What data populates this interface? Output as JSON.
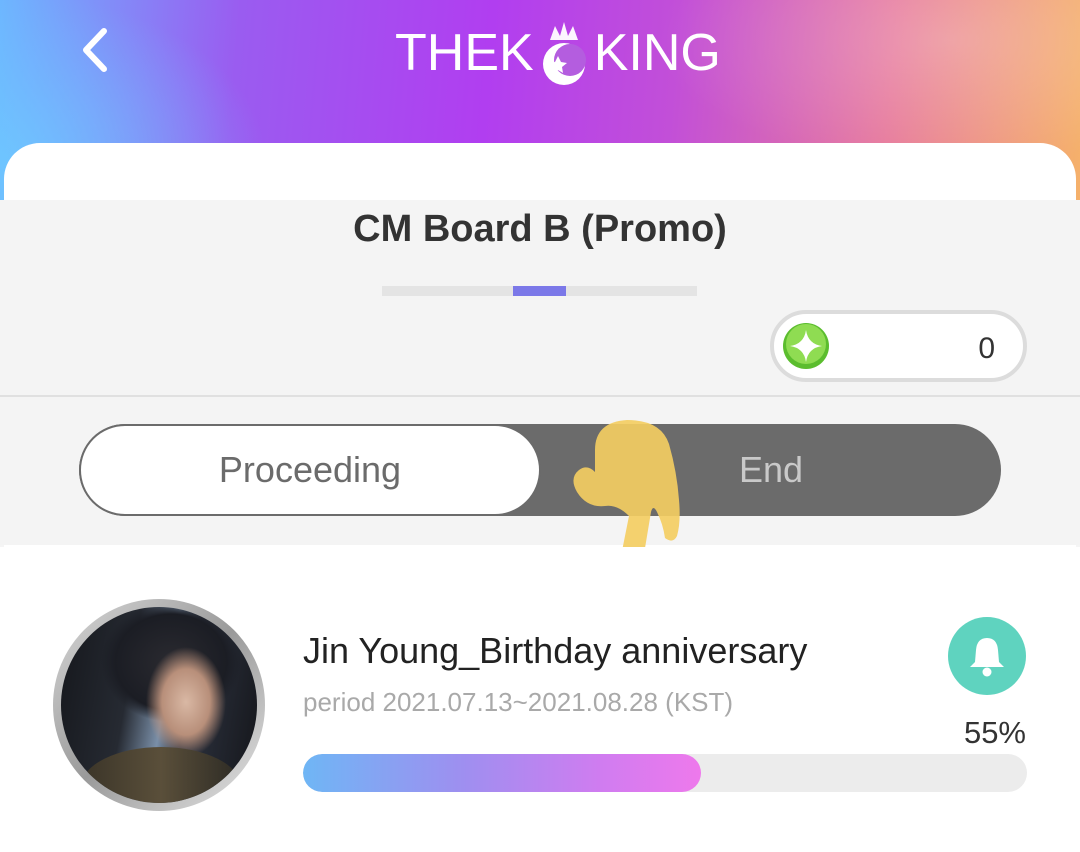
{
  "header": {
    "logo_left": "THEK",
    "logo_right": "KING",
    "back_icon": "chevron-left-icon"
  },
  "board": {
    "title": "CM Board B (Promo)",
    "indicator": {
      "page": 3,
      "total": 6
    }
  },
  "points": {
    "icon": "sparkle-star-icon",
    "value": "0"
  },
  "toggle": {
    "proceeding_label": "Proceeding",
    "end_label": "End",
    "selected": "Proceeding"
  },
  "events": [
    {
      "title": "Jin Young_Birthday anniversary",
      "period": "period 2021.07.13~2021.08.28 (KST)",
      "percent_label": "55%",
      "progress": 0.55,
      "alert_icon": "bell-icon"
    }
  ],
  "colors": {
    "accent": "#7b78e8",
    "bell": "#5fd3bf",
    "toggle_dark": "#6b6b6b",
    "points_green": "#6fc93a"
  }
}
